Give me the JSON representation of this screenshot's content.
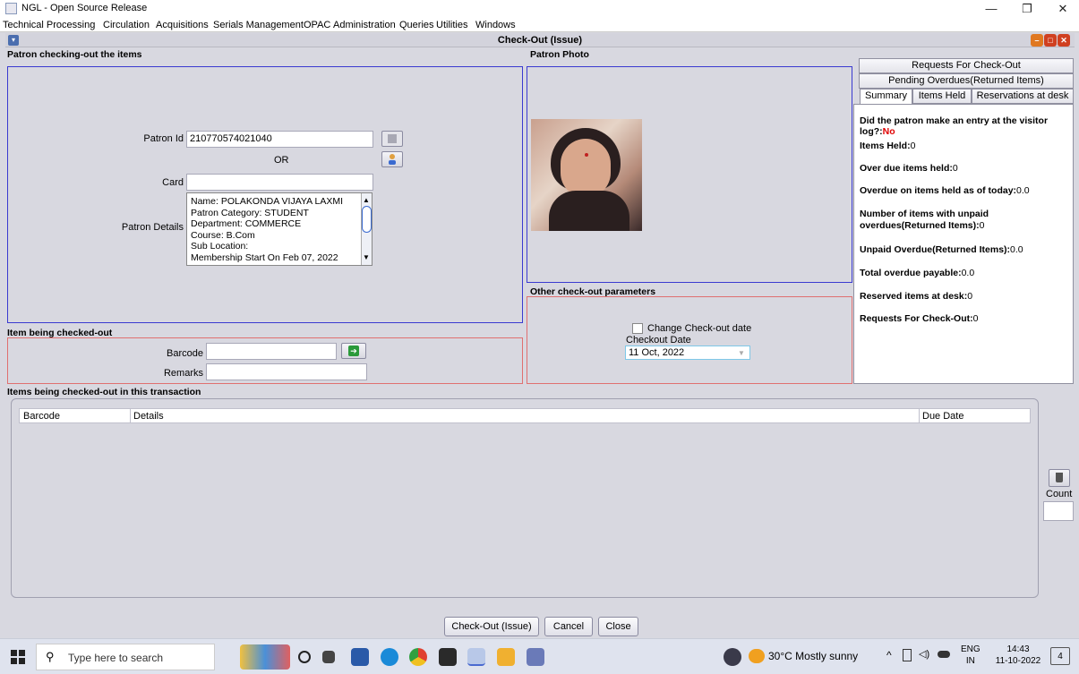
{
  "window": {
    "title": "NGL - Open Source Release",
    "minimize": "—",
    "maximize": "❐",
    "close": "✕"
  },
  "menu": [
    "Technical Processing",
    "Circulation",
    "Acquisitions",
    "Serials Management",
    "OPAC",
    "Administration",
    "Queries",
    "Utilities",
    "Windows"
  ],
  "frame": {
    "title": "Check-Out (Issue)",
    "minimize": "–",
    "maximize": "□",
    "close": "✕"
  },
  "patron": {
    "section_title": "Patron checking-out the items",
    "id_label": "Patron Id",
    "id_value": "210770574021040",
    "or_label": "OR",
    "card_label": "Card",
    "card_value": "",
    "details_label": "Patron Details",
    "details_lines": [
      "Name:  POLAKONDA VIJAYA LAXMI",
      "Patron Category: STUDENT",
      "Department: COMMERCE",
      "Course: B.Com",
      "Sub Location:",
      "Membership Start On Feb 07, 2022"
    ]
  },
  "photo": {
    "section_title": "Patron Photo"
  },
  "params": {
    "section_title": "Other check-out parameters",
    "change_date_label": "Change Check-out date",
    "checkout_date_label": "Checkout Date",
    "checkout_date_value": "11 Oct, 2022"
  },
  "item": {
    "section_title": "Item being checked-out",
    "barcode_label": "Barcode",
    "barcode_value": "",
    "remarks_label": "Remarks",
    "remarks_value": ""
  },
  "transaction": {
    "section_title": "Items being checked-out in this transaction",
    "columns": [
      "Barcode",
      "Details",
      "Due Date"
    ],
    "count_label": "Count",
    "count_value": ""
  },
  "tabs": {
    "row1": "Requests For Check-Out",
    "row2": "Pending Overdues(Returned Items)",
    "row3": [
      "Summary",
      "Items Held",
      "Reservations at desk"
    ],
    "active": "Summary"
  },
  "summary": {
    "visitor_log_label": "Did the patron make an entry at the visitor log?:",
    "visitor_log_value": "No",
    "items_held_label": "Items Held:",
    "items_held_value": "0",
    "overdue_items_label": "Over due items held:",
    "overdue_items_value": "0",
    "overdue_today_label": "Overdue on items held as of today:",
    "overdue_today_value": "0.0",
    "unpaid_count_label": "Number of items with unpaid overdues(Returned Items):",
    "unpaid_count_value": "0",
    "unpaid_overdue_label": "Unpaid Overdue(Returned Items):",
    "unpaid_overdue_value": "0.0",
    "total_payable_label": "Total overdue payable:",
    "total_payable_value": "0.0",
    "reserved_label": "Reserved items at desk:",
    "reserved_value": "0",
    "requests_label": "Requests For Check-Out:",
    "requests_value": "0"
  },
  "buttons": {
    "checkout": "Check-Out (Issue)",
    "cancel": "Cancel",
    "close": "Close"
  },
  "taskbar": {
    "search_placeholder": "Type here to search",
    "weather": "30°C  Mostly sunny",
    "lang": "ENG",
    "region": "IN",
    "time": "14:43",
    "date": "11-10-2022",
    "notifications": "4"
  },
  "colors": {
    "section_border_blue": "#3a3ad0",
    "section_border_red": "#e07070",
    "alert_red": "#e00000",
    "frame_close": "#d04020",
    "frame_min": "#e07820",
    "frame_max": "#d04020"
  }
}
